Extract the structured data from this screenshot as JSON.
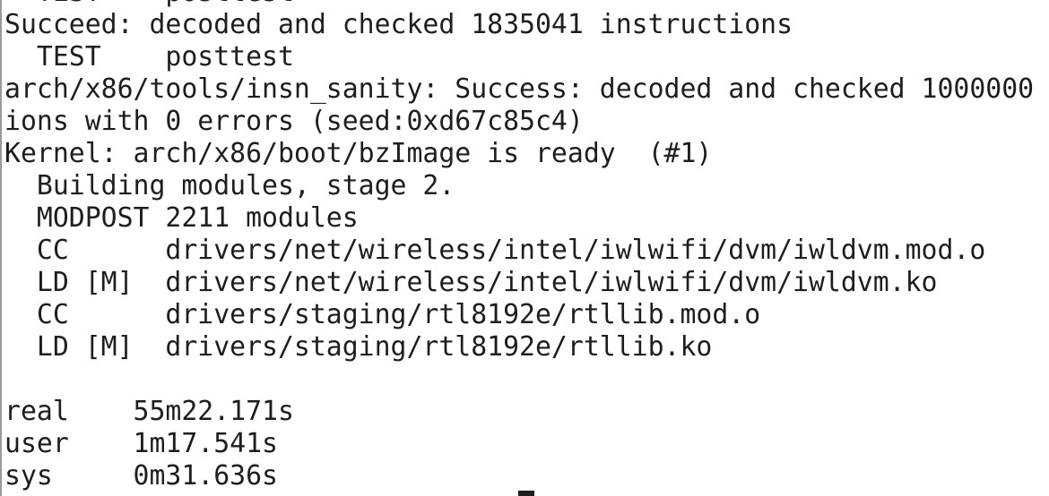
{
  "terminal": {
    "lines": [
      "  TEST    posttest",
      "Succeed: decoded and checked 1835041 instructions",
      "  TEST    posttest",
      "arch/x86/tools/insn_sanity: Success: decoded and checked 1000000",
      "ions with 0 errors (seed:0xd67c85c4)",
      "Kernel: arch/x86/boot/bzImage is ready  (#1)",
      "  Building modules, stage 2.",
      "  MODPOST 2211 modules",
      "  CC      drivers/net/wireless/intel/iwlwifi/dvm/iwldvm.mod.o",
      "  LD [M]  drivers/net/wireless/intel/iwlwifi/dvm/iwldvm.ko",
      "  CC      drivers/staging/rtl8192e/rtllib.mod.o",
      "  LD [M]  drivers/staging/rtl8192e/rtllib.ko",
      "",
      "real    55m22.171s",
      "user    1m17.541s",
      "sys     0m31.636s"
    ]
  }
}
